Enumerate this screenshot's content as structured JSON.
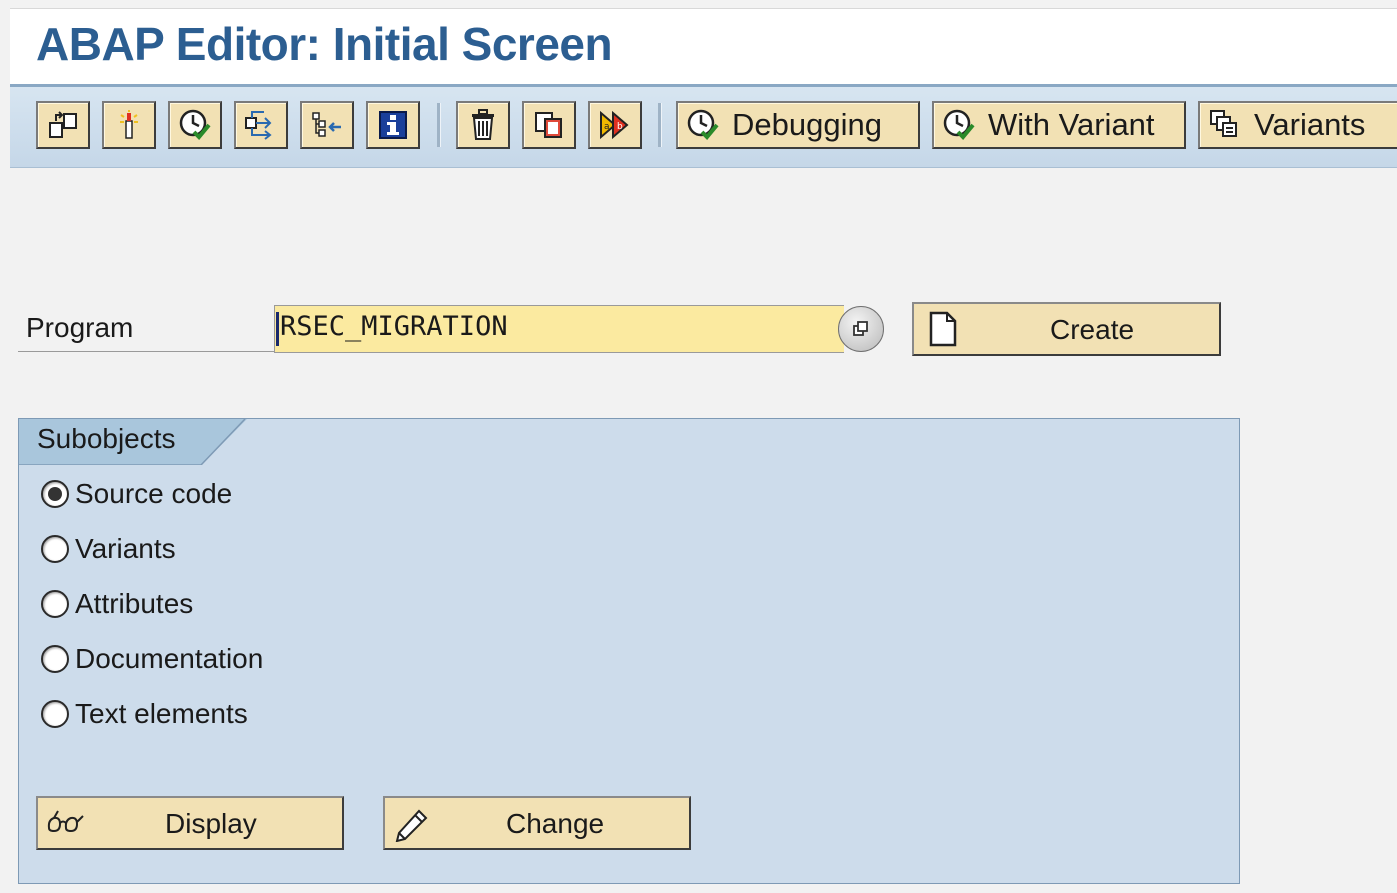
{
  "window": {
    "title": "ABAP Editor: Initial Screen"
  },
  "toolbar": {
    "icon_buttons": [
      {
        "name": "other-object-icon"
      },
      {
        "name": "object-list-icon"
      },
      {
        "name": "execute-icon"
      },
      {
        "name": "where-used-icon"
      },
      {
        "name": "display-object-list-icon"
      },
      {
        "name": "information-icon"
      },
      {
        "name": "delete-icon"
      },
      {
        "name": "copy-icon"
      },
      {
        "name": "rename-icon"
      }
    ],
    "debugging_label": "Debugging",
    "with_variant_label": "With Variant",
    "variants_label": "Variants"
  },
  "program": {
    "label": "Program",
    "value": "RSEC_MIGRATION",
    "create_label": "Create"
  },
  "subobjects": {
    "title": "Subobjects",
    "options": [
      {
        "label": "Source code",
        "selected": true
      },
      {
        "label": "Variants",
        "selected": false
      },
      {
        "label": "Attributes",
        "selected": false
      },
      {
        "label": "Documentation",
        "selected": false
      },
      {
        "label": "Text elements",
        "selected": false
      }
    ],
    "display_label": "Display",
    "change_label": "Change"
  },
  "colors": {
    "title": "#2c5e91",
    "button_face": "#f2e1b4",
    "input_bg": "#fbeaa0",
    "group_bg": "#cddceb",
    "toolbar_bg": "#c5d7e8"
  }
}
